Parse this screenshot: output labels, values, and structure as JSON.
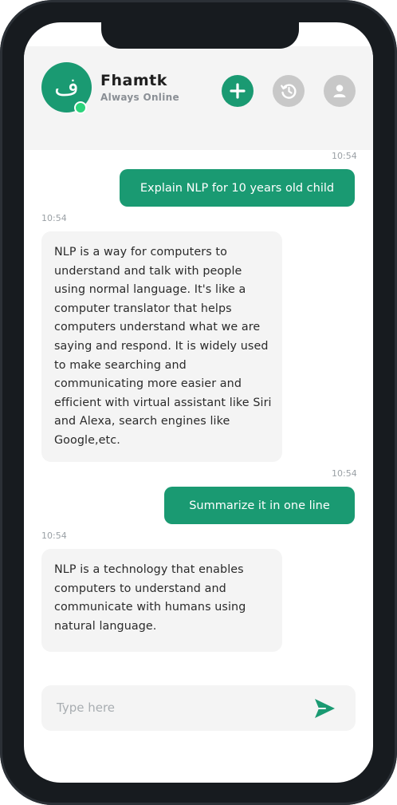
{
  "header": {
    "avatar_glyph": "ف",
    "bot_name": "Fhamtk",
    "status": "Always Online"
  },
  "icons": {
    "add": "plus-icon",
    "history": "history-icon",
    "profile": "user-icon",
    "send": "send-icon"
  },
  "colors": {
    "accent": "#1a9a72",
    "online": "#2bd37b",
    "bubble_bot": "#f4f4f4",
    "muted_button": "#c8c8c8"
  },
  "messages": [
    {
      "sender": "user",
      "time": "10:54",
      "text": "Explain NLP for 10 years old child"
    },
    {
      "sender": "bot",
      "time": "10:54",
      "text": "NLP is a way for computers to understand and talk with people using normal language. It's like a computer translator that helps computers understand what we are saying and respond. It is widely used to make searching and communicating more easier and efficient with virtual assistant like Siri and Alexa, search engines like Google,etc."
    },
    {
      "sender": "user",
      "time": "10:54",
      "text": "Summarize it in one line"
    },
    {
      "sender": "bot",
      "time": "10:54",
      "text": "NLP is a technology that enables computers to understand and communicate with humans using natural language."
    }
  ],
  "composer": {
    "placeholder": "Type here"
  }
}
